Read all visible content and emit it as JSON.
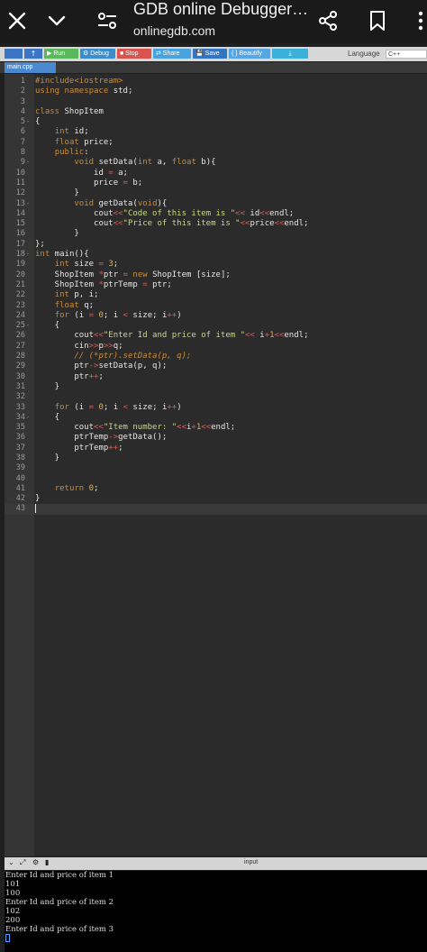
{
  "browser": {
    "title": "GDB online Debugger…",
    "url": "onlinegdb.com"
  },
  "toolbar": {
    "run": "▶ Run",
    "debug": "⚙ Debug",
    "stop": "■ Stop",
    "share": "⇄ Share",
    "save": "💾 Save",
    "beautify": "{ } Beautify",
    "download": "⤓",
    "language_label": "Language",
    "language_value": "C++"
  },
  "tabs": {
    "file": "main.cpp"
  },
  "colors": {
    "run": "#5cb85c",
    "debug": "#3c8dcb",
    "stop": "#d9534f",
    "share": "#4aa3df",
    "save": "#3275c3",
    "beautify": "#54a7e4",
    "download": "#3bb0d8",
    "keyword": "#c98b3d",
    "string": "#c9d97e",
    "number": "#d5b15f",
    "operator": "#d35f5f",
    "preproc": "#c98b3d",
    "comment": "#c98b3d",
    "plain": "#e6e6e6"
  },
  "code_lines": [
    {
      "n": "1",
      "fold": "",
      "t": "#include<iostream>"
    },
    {
      "n": "2",
      "fold": "",
      "t": "using namespace std;"
    },
    {
      "n": "3",
      "fold": "",
      "t": ""
    },
    {
      "n": "4",
      "fold": "",
      "t": "class ShopItem"
    },
    {
      "n": "5",
      "fold": "-",
      "t": "{"
    },
    {
      "n": "6",
      "fold": "",
      "t": "    int id;"
    },
    {
      "n": "7",
      "fold": "",
      "t": "    float price;"
    },
    {
      "n": "8",
      "fold": "",
      "t": "    public:"
    },
    {
      "n": "9",
      "fold": "-",
      "t": "        void setData(int a, float b){"
    },
    {
      "n": "10",
      "fold": "",
      "t": "            id = a;"
    },
    {
      "n": "11",
      "fold": "",
      "t": "            price = b;"
    },
    {
      "n": "12",
      "fold": "",
      "t": "        }"
    },
    {
      "n": "13",
      "fold": "-",
      "t": "        void getData(void){"
    },
    {
      "n": "14",
      "fold": "",
      "t": "            cout<<\"Code of this item is \"<< id<<endl;"
    },
    {
      "n": "15",
      "fold": "",
      "t": "            cout<<\"Price of this item is \"<<price<<endl;"
    },
    {
      "n": "16",
      "fold": "",
      "t": "        }"
    },
    {
      "n": "17",
      "fold": "",
      "t": "};"
    },
    {
      "n": "18",
      "fold": "-",
      "t": "int main(){"
    },
    {
      "n": "19",
      "fold": "",
      "t": "    int size = 3;"
    },
    {
      "n": "20",
      "fold": "",
      "t": "    ShopItem *ptr = new ShopItem [size];"
    },
    {
      "n": "21",
      "fold": "",
      "t": "    ShopItem *ptrTemp = ptr;"
    },
    {
      "n": "22",
      "fold": "",
      "t": "    int p, i;"
    },
    {
      "n": "23",
      "fold": "",
      "t": "    float q;"
    },
    {
      "n": "24",
      "fold": "",
      "t": "    for (i = 0; i < size; i++)"
    },
    {
      "n": "25",
      "fold": "-",
      "t": "    {"
    },
    {
      "n": "26",
      "fold": "",
      "t": "        cout<<\"Enter Id and price of item \"<< i+1<<endl;"
    },
    {
      "n": "27",
      "fold": "",
      "t": "        cin>>p>>q;"
    },
    {
      "n": "28",
      "fold": "",
      "t": "        // (*ptr).setData(p, q);"
    },
    {
      "n": "29",
      "fold": "",
      "t": "        ptr->setData(p, q);"
    },
    {
      "n": "30",
      "fold": "",
      "t": "        ptr++;"
    },
    {
      "n": "31",
      "fold": "",
      "t": "    }"
    },
    {
      "n": "32",
      "fold": "",
      "t": ""
    },
    {
      "n": "33",
      "fold": "",
      "t": "    for (i = 0; i < size; i++)"
    },
    {
      "n": "34",
      "fold": "-",
      "t": "    {"
    },
    {
      "n": "35",
      "fold": "",
      "t": "        cout<<\"Item number: \"<<i+1<<endl;"
    },
    {
      "n": "36",
      "fold": "",
      "t": "        ptrTemp->getData();"
    },
    {
      "n": "37",
      "fold": "",
      "t": "        ptrTemp++;"
    },
    {
      "n": "38",
      "fold": "",
      "t": "    }"
    },
    {
      "n": "39",
      "fold": "",
      "t": ""
    },
    {
      "n": "40",
      "fold": "",
      "t": ""
    },
    {
      "n": "41",
      "fold": "",
      "t": "    return 0;"
    },
    {
      "n": "42",
      "fold": "",
      "t": "}"
    },
    {
      "n": "43",
      "fold": "",
      "t": ""
    }
  ],
  "io": {
    "input_label": "input"
  },
  "console_lines": [
    "Enter Id and price of item 1",
    "101",
    "100",
    "Enter Id and price of item 2",
    "102",
    "200",
    "Enter Id and price of item 3"
  ]
}
